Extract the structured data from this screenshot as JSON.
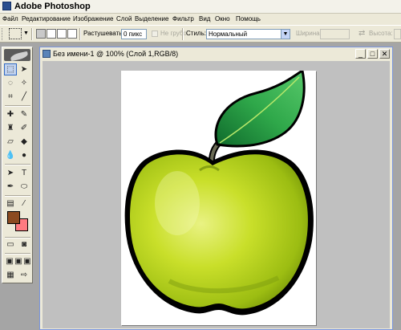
{
  "app": {
    "title": "Adobe Photoshop",
    "icon": "photoshop-icon"
  },
  "menubar": {
    "items": [
      {
        "label": "Файл"
      },
      {
        "label": "Редактирование"
      },
      {
        "label": "Изображение"
      },
      {
        "label": "Слой"
      },
      {
        "label": "Выделение"
      },
      {
        "label": "Фильтр"
      },
      {
        "label": "Вид"
      },
      {
        "label": "Окно"
      },
      {
        "label": "Помощь"
      }
    ]
  },
  "options": {
    "feather_label": "Растушевать:",
    "feather_value": "0 пикс",
    "antialias_label": "Не грубо",
    "style_label": "Стиль:",
    "style_value": "Нормальный",
    "width_label": "Ширина:",
    "height_label": "Высота:"
  },
  "document": {
    "title": "Без имени-1 @ 100% (Слой 1,RGB/8)",
    "content": "apple-illustration"
  },
  "colors": {
    "foreground": "#8b4a20",
    "background": "#ff7a80",
    "workspace": "#a5a5a5"
  }
}
